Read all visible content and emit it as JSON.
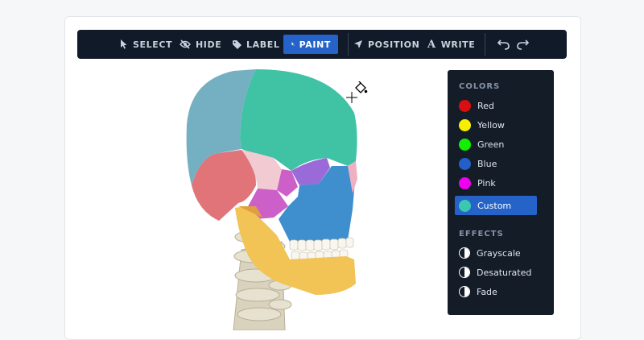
{
  "toolbar": {
    "select_label": "SELECT",
    "hide_label": "HIDE",
    "label_label": "LABEL",
    "paint_label": "PAINT",
    "position_label": "POSITION",
    "write_label": "WRITE",
    "write_glyph": "A"
  },
  "panel": {
    "colors_title": "COLORS",
    "colors": [
      {
        "label": "Red",
        "hex": "#d80f10"
      },
      {
        "label": "Yellow",
        "hex": "#f6f000"
      },
      {
        "label": "Green",
        "hex": "#11f000"
      },
      {
        "label": "Blue",
        "hex": "#2260c8"
      },
      {
        "label": "Pink",
        "hex": "#ee00f0"
      },
      {
        "label": "Custom",
        "hex": "#3bc8b0",
        "selected": true
      }
    ],
    "effects_title": "EFFECTS",
    "effects": [
      {
        "label": "Grayscale"
      },
      {
        "label": "Desaturated"
      },
      {
        "label": "Fade"
      }
    ]
  },
  "theme": {
    "toolbar_bg": "#101a28",
    "accent": "#2563c9",
    "panel_bg": "#141c28"
  }
}
